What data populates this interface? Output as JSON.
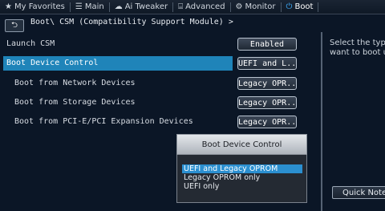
{
  "nav": {
    "items": [
      {
        "label": "My Favorites",
        "icon": "star-icon"
      },
      {
        "label": "Main",
        "icon": "list-icon"
      },
      {
        "label": "Ai Tweaker",
        "icon": "tweaker-icon"
      },
      {
        "label": "Advanced",
        "icon": "advanced-icon"
      },
      {
        "label": "Monitor",
        "icon": "monitor-icon"
      },
      {
        "label": "Boot",
        "icon": "power-icon"
      }
    ]
  },
  "breadcrumb": "Boot\\ CSM (Compatibility Support Module) >",
  "rows": [
    {
      "label": "Launch CSM",
      "value": "Enabled"
    },
    {
      "label": "Boot Device Control",
      "value": "UEFI and L..."
    },
    {
      "label": "Boot from Network Devices",
      "value": "Legacy OPR..."
    },
    {
      "label": "Boot from Storage Devices",
      "value": "Legacy OPR..."
    },
    {
      "label": "Boot from PCI-E/PCI Expansion Devices",
      "value": "Legacy OPR..."
    }
  ],
  "help": {
    "line1": "Select the typ",
    "line2": "want to boot u"
  },
  "quick_note": "Quick Note",
  "popup": {
    "title": "Boot Device Control",
    "options": [
      "UEFI and Legacy OPROM",
      "Legacy OPROM only",
      "UEFI only"
    ]
  },
  "colors": {
    "background": "#0b1626",
    "selection": "#1f84b9",
    "boot_accent": "#3fb0ff"
  }
}
